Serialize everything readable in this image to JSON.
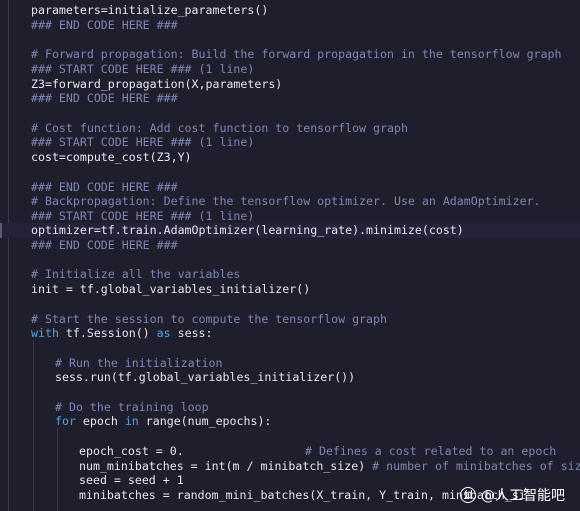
{
  "colors": {
    "background": "#1f1e2c",
    "comment": "#7f86b3",
    "keyword": "#4fa3e0",
    "default": "#e6e6ef",
    "function": "#e9d98a"
  },
  "code": {
    "l0": "parameters=initialize_parameters()",
    "l1": "### END CODE HERE ###",
    "l2": "# Forward propagation: Build the forward propagation in the tensorflow graph",
    "l3": "### START CODE HERE ### (1 line)",
    "l4": "Z3=forward_propagation(X,parameters)",
    "l5": "### END CODE HERE ###",
    "l6": "# Cost function: Add cost function to tensorflow graph",
    "l7": "### START CODE HERE ### (1 line)",
    "l8": "cost=compute_cost(Z3,Y)",
    "l9": "### END CODE HERE ###",
    "l10": "# Backpropagation: Define the tensorflow optimizer. Use an AdamOptimizer.",
    "l11": "### START CODE HERE ### (1 line)",
    "l12": "optimizer=tf.train.AdamOptimizer(learning_rate).minimize(cost)",
    "l13": "### END CODE HERE ###",
    "l14": "# Initialize all the variables",
    "l15": "init = tf.global_variables_initializer()",
    "l16": "# Start the session to compute the tensorflow graph",
    "l17_kw1": "with",
    "l17_mid": " tf.Session() ",
    "l17_kw2": "as",
    "l17_end": " sess:",
    "l18": "# Run the initialization",
    "l19": "sess.run(tf.global_variables_initializer())",
    "l20": "# Do the training loop",
    "l21_kw1": "for",
    "l21_mid": " epoch ",
    "l21_kw2": "in",
    "l21_end": " range(num_epochs):",
    "l22_code": "epoch_cost = 0.",
    "l22_cmt": "# Defines a cost related to an epoch",
    "l23_code": "num_minibatches = int(m / minibatch_size)",
    "l23_cmt": "# number of minibatches of size minibatch_",
    "l24": "seed = seed + 1",
    "l25": "minibatches = random_mini_batches(X_train, Y_train, minibatch_si"
  },
  "watermark": {
    "logo_text": "知",
    "text": "@人工智能吧"
  }
}
